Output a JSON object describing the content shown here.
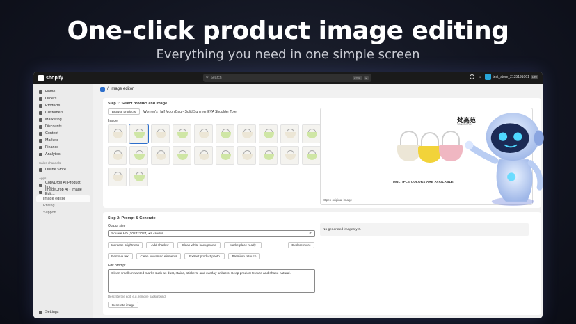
{
  "hero": {
    "title": "One-click product image editing",
    "subtitle": "Everything you need in one simple screen"
  },
  "topbar": {
    "logo": "shopify",
    "search_placeholder": "Search",
    "shortcut_keys": [
      "CTRL",
      "K"
    ],
    "store_name": "test_store_2135191061",
    "store_badge": "Dev"
  },
  "sidebar": {
    "items": [
      {
        "label": "Home",
        "icon": "home-icon"
      },
      {
        "label": "Orders",
        "icon": "orders-icon"
      },
      {
        "label": "Products",
        "icon": "tag-icon"
      },
      {
        "label": "Customers",
        "icon": "person-icon"
      },
      {
        "label": "Marketing",
        "icon": "target-icon"
      },
      {
        "label": "Discounts",
        "icon": "discount-icon"
      },
      {
        "label": "Content",
        "icon": "content-icon"
      },
      {
        "label": "Markets",
        "icon": "globe-icon"
      },
      {
        "label": "Finance",
        "icon": "bank-icon"
      },
      {
        "label": "Analytics",
        "icon": "chart-icon"
      }
    ],
    "sales_channels_heading": "Sales channels",
    "sales_channels": [
      {
        "label": "Online Store",
        "icon": "store-icon"
      }
    ],
    "apps_heading": "Apps",
    "apps": [
      {
        "label": "CopyDrop AI Product Imp...",
        "icon": "app-icon"
      },
      {
        "label": "ImageDrop AI - Image Edit...",
        "icon": "app-icon"
      }
    ],
    "app_subitems": [
      "Image editor",
      "Pricing",
      "Support"
    ],
    "settings": "Settings"
  },
  "page": {
    "breadcrumb_separator": "/",
    "title": "Image editor",
    "more": "···"
  },
  "step1": {
    "heading": "Step 1: Select product and image",
    "browse_button": "Browse products",
    "product_name": "Women's Half Moon Bag - Solid Summer EVA Shoulder Tote",
    "image_label": "Image",
    "preview": {
      "brand": "梵高范",
      "brand_sub": "TONGHOTON",
      "tagline": "MULTIPLE COLORS ARE AVAILABLE.",
      "link": "Open original image"
    }
  },
  "step2": {
    "heading": "Step 2: Prompt & Generate",
    "output_size_label": "Output size",
    "output_size_value": "Square HD (1024x1024) • 8 credits",
    "quick_row1": [
      "Increase brightness",
      "Add shadow",
      "Clean white background",
      "Marketplace ready"
    ],
    "explore_button": "Explore more",
    "quick_row2": [
      "Remove text",
      "Clean unwanted elements",
      "Extract product photo",
      "Premium retouch"
    ],
    "edit_prompt_label": "Edit prompt",
    "edit_prompt_value": "Clean small unwanted marks such as dust, stains, stickers, and overlay artifacts. Keep product texture and shape natural.",
    "hint": "Describe the edit, e.g. remove background",
    "generate_button": "Generate image",
    "empty_state": "No generated images yet."
  },
  "colors": {
    "accent": "#2c6ecb",
    "bag_yellow": "#f2d33a",
    "bag_white": "#ece6d6",
    "bag_pink": "#f0b7c2"
  }
}
